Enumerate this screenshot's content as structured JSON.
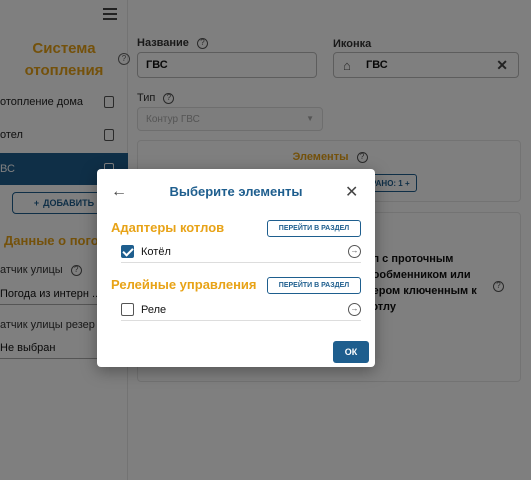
{
  "sidebar": {
    "title": "Система отопления",
    "items": [
      {
        "label": "отопление дома"
      },
      {
        "label": "отел"
      },
      {
        "label": "ВС"
      }
    ],
    "add_label": "ДОБАВИТЬ",
    "add_icon": "+",
    "section_title": "Данные о пого",
    "street_sensor_label": "атчик улицы",
    "street_sensor_value": "Погода из интерн ...",
    "reserve_sensor_label": "атчик улицы резер",
    "reserve_sensor_value": "Не выбран"
  },
  "form": {
    "name_label": "Название",
    "name_value": "ГВС",
    "icon_label": "Иконка",
    "icon_value": "ГВС",
    "type_label": "Тип",
    "type_value": "Контур ГВС",
    "elements_title": "Элементы",
    "elements_chip": "РАНО: 1  +",
    "description": "ел с проточным пообменником или пером ключенным к котлу"
  },
  "dialog": {
    "title": "Выберите элементы",
    "groups": [
      {
        "title": "Адаптеры котлов",
        "goto_label": "ПЕРЕЙТИ В РАЗДЕЛ",
        "items": [
          {
            "label": "Котёл",
            "checked": true
          }
        ]
      },
      {
        "title": "Релейные управления",
        "goto_label": "ПЕРЕЙТИ В РАЗДЕЛ",
        "items": [
          {
            "label": "Реле",
            "checked": false
          }
        ]
      }
    ],
    "ok_label": "ОК"
  },
  "colors": {
    "accent": "#e8a317",
    "primary": "#1e5e8e"
  }
}
